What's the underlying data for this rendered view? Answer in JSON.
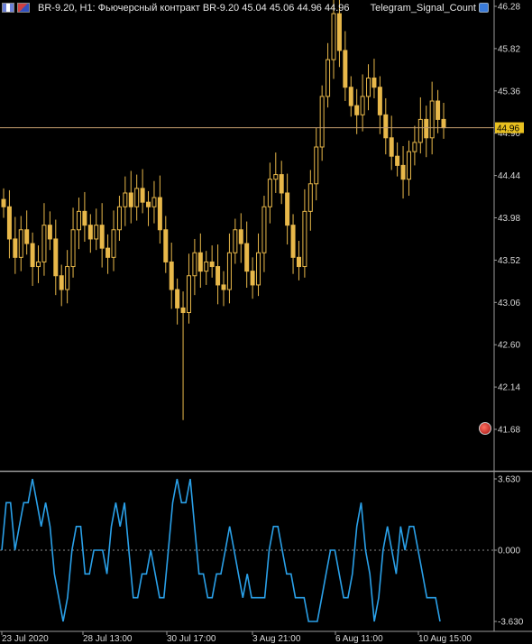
{
  "header": {
    "title": "BR-9.20, H1:  Фьючерсный контракт BR-9.20  45.04 45.06 44.96 44.96",
    "indicator_name": "Telegram_Signal_Count"
  },
  "colors": {
    "background": "#000000",
    "candle": "#e8b84a",
    "indicator": "#2aa0e8",
    "price_line": "#c8a070",
    "price_label_bg": "#e8c020",
    "axis_text": "#d8d8d8",
    "separator": "#9a9a9a"
  },
  "icons": [
    "chart-window-icon",
    "symbol-flag-icon",
    "indicator-badge-icon",
    "cursor-marker-icon"
  ],
  "chart_data": [
    {
      "type": "candlestick",
      "title": "BR-9.20, H1",
      "ylim": [
        41.45,
        46.35
      ],
      "yticks": [
        "46.28",
        "45.82",
        "45.36",
        "44.90",
        "44.44",
        "43.98",
        "43.52",
        "43.06",
        "42.60",
        "42.14",
        "41.68"
      ],
      "current_price": "44.96",
      "xticks": [
        "23 Jul 2020",
        "28 Jul 13:00",
        "30 Jul 17:00",
        "3 Aug 21:00",
        "6 Aug 11:00",
        "10 Aug 15:00"
      ],
      "series": [
        {
          "values": [
            44.1,
            43.75,
            43.55,
            43.85,
            43.7,
            43.45,
            43.5,
            43.9,
            43.75,
            43.35,
            43.2,
            43.45,
            43.85,
            44.05,
            43.9,
            43.75,
            43.9,
            43.65,
            43.55,
            43.85,
            44.1,
            44.25,
            44.1,
            44.3,
            44.15,
            44.1,
            44.2,
            43.85,
            43.5,
            43.2,
            43.0,
            42.95,
            43.35,
            43.6,
            43.4,
            43.5,
            43.45,
            43.25,
            43.2,
            43.6,
            43.85,
            43.7,
            43.4,
            43.25,
            43.6,
            44.1,
            44.4,
            44.45,
            44.25,
            43.9,
            43.55,
            43.45,
            44.05,
            44.35,
            44.75,
            45.3,
            45.7,
            46.2,
            45.8,
            45.4,
            45.2,
            45.1,
            45.3,
            45.5,
            45.4,
            45.1,
            44.85,
            44.65,
            44.55,
            44.4,
            44.7,
            44.8,
            45.05,
            44.85,
            45.25,
            45.05,
            44.96
          ]
        }
      ]
    },
    {
      "type": "line",
      "title": "Telegram_Signal_Count",
      "ylim": [
        -3.63,
        3.63
      ],
      "yticks": [
        "3.630",
        "0.000",
        "-3.630"
      ],
      "series": [
        {
          "values": [
            0,
            2,
            2,
            0,
            1,
            2,
            2,
            3,
            2,
            1,
            2,
            1,
            -1,
            -2,
            -3,
            -2,
            0,
            1,
            1,
            -1,
            -1,
            0,
            0,
            0,
            -1,
            1,
            2,
            1,
            2,
            0,
            -2,
            -2,
            -1,
            -1,
            0,
            -1,
            -2,
            -2,
            0,
            2,
            3,
            2,
            2,
            3,
            1,
            -1,
            -1,
            -2,
            -2,
            -1,
            -1,
            0,
            1,
            0,
            -1,
            -2,
            -1,
            -2,
            -2,
            -2,
            -2,
            0,
            1,
            1,
            0,
            -1,
            -1,
            -2,
            -2,
            -2,
            -3,
            -3,
            -3,
            -2,
            -1,
            0,
            0,
            -1,
            -2,
            -2,
            -1,
            1,
            2,
            0,
            -1,
            -3,
            -2,
            0,
            1,
            0,
            -1,
            1,
            0,
            1,
            1,
            0,
            -1,
            -2,
            -2,
            -2,
            -3
          ]
        }
      ]
    }
  ]
}
